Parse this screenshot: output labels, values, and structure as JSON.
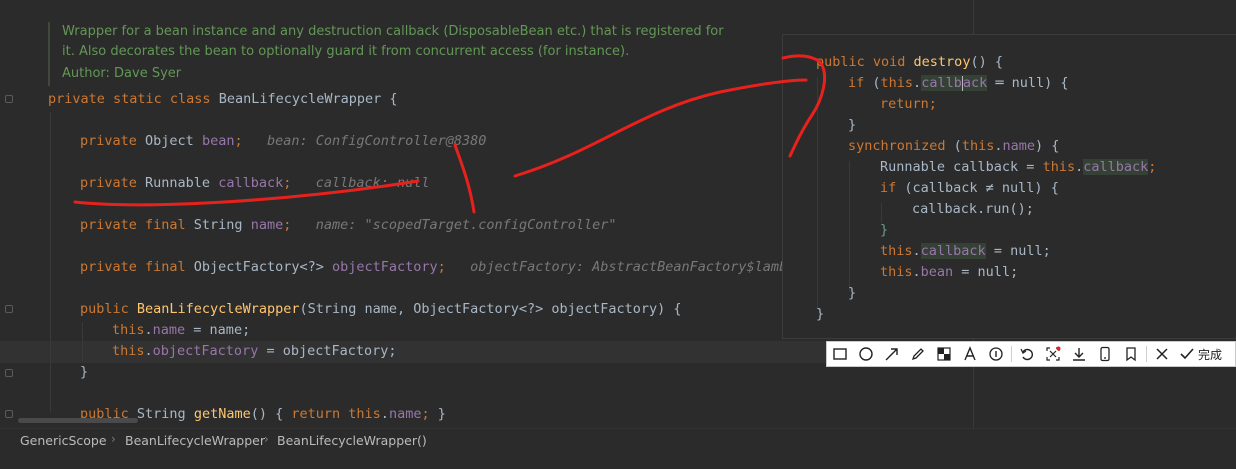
{
  "editor": {
    "doc_comment": {
      "lines": [
        "Wrapper for a bean instance and any destruction callback (DisposableBean etc.) that is registered for",
        "it. Also decorates the bean to optionally guard it from concurrent access (for instance)."
      ],
      "author": "Author: Dave Syer"
    },
    "class_decl": {
      "kw": "private static class ",
      "name": "BeanLifecycleWrapper",
      "brace": " {"
    },
    "field_bean": {
      "kw": "private ",
      "type": "Object ",
      "name": "bean",
      "semi": ";",
      "hint": "bean: ConfigController@8380"
    },
    "field_callback": {
      "kw": "private ",
      "type": "Runnable ",
      "name": "callback",
      "semi": ";",
      "hint": "callback: null"
    },
    "field_name": {
      "kw": "private final ",
      "type": "String ",
      "name": "name",
      "semi": ";",
      "hint": "name: \"scopedTarget.configController\""
    },
    "field_factory": {
      "kw": "private final ",
      "type": "ObjectFactory<?> ",
      "name": "objectFactory",
      "semi": ";",
      "hint": "objectFactory: AbstractBeanFactory$lambda"
    },
    "ctor": {
      "kw": "public ",
      "name": "BeanLifecycleWrapper",
      "params": "(String name, ObjectFactory<?> objectFactory) {"
    },
    "ctor_body_1": {
      "this": "this",
      "dot": ".",
      "field": "name",
      "rest": " = name;"
    },
    "ctor_body_2": {
      "this": "this",
      "dot": ".",
      "field": "objectFactory",
      "rest": " = objectFactory;"
    },
    "ctor_close": "}",
    "getname": {
      "kw": "public ",
      "type": "String ",
      "name": "getName",
      "p": "() ",
      "b1": "{ ",
      "ret": "return ",
      "this": "this",
      "dot": ".",
      "field": "name",
      "semi": "; ",
      "b2": "}"
    }
  },
  "popup": {
    "l1": {
      "kw": "public void ",
      "name": "destroy",
      "rest": "() {"
    },
    "l2": {
      "kw": "if ",
      "p": "(",
      "this": "this",
      "dot": ".",
      "f1": "callb",
      "f2": "ack",
      "rest": " ═ null) {"
    },
    "l3": {
      "kw": "return",
      "semi": ";"
    },
    "l4": "}",
    "l5": {
      "kw": "synchronized ",
      "p": "(",
      "this": "this",
      "dot": ".",
      "field": "name",
      "rest": ") {"
    },
    "l6": {
      "type": "Runnable callback = ",
      "this": "this",
      "dot": ".",
      "field": "callback",
      "semi": ";"
    },
    "l7": {
      "kw": "if ",
      "rest": "(callback ≠ null) {"
    },
    "l8": "callback.run();",
    "l9": "}",
    "l10": {
      "this": "this",
      "dot": ".",
      "field": "callback",
      "rest": " = null;"
    },
    "l11": {
      "this": "this",
      "dot": ".",
      "field": "bean",
      "rest": " = null;"
    },
    "l12": "}",
    "l13": "}"
  },
  "breadcrumb": {
    "items": [
      "GenericScope",
      "BeanLifecycleWrapper",
      "BeanLifecycleWrapper()"
    ]
  },
  "toolbar": {
    "tools": [
      "rectangle-tool",
      "ellipse-tool",
      "arrow-tool",
      "pen-tool",
      "mosaic-tool",
      "text-tool",
      "number-tool",
      "undo-tool",
      "ocr-tool",
      "download-tool",
      "phone-tool",
      "pin-tool",
      "close-tool"
    ],
    "done_label": "完成"
  },
  "colors": {
    "annotation_red": "#e8211c",
    "keyword": "#cc7832",
    "field": "#9876aa",
    "method": "#ffc66d",
    "comment": "#629755"
  }
}
